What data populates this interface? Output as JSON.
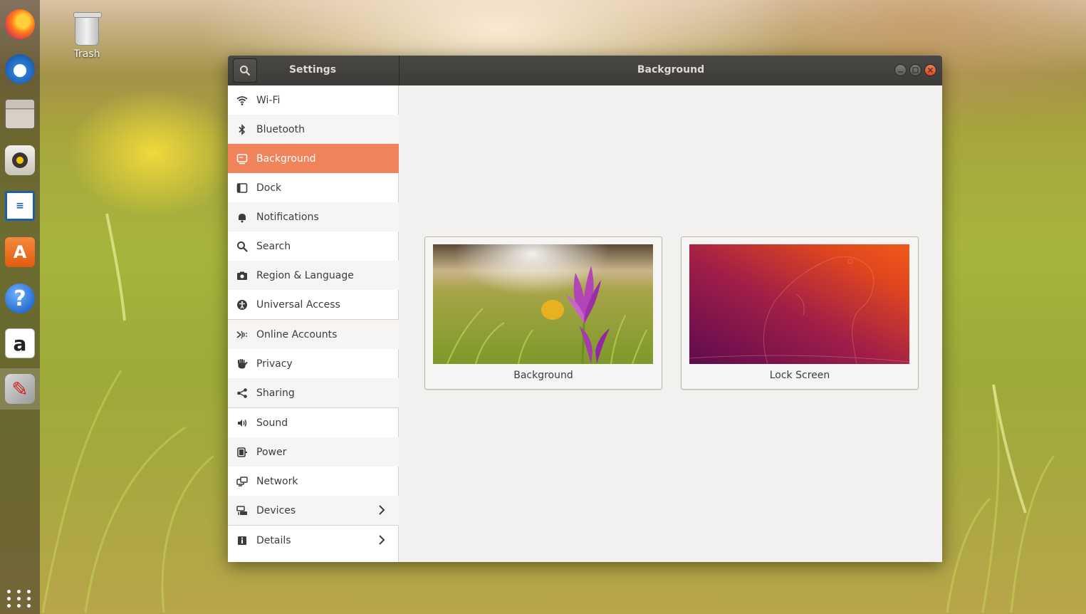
{
  "desktop": {
    "trash_label": "Trash",
    "dock_apps": [
      "firefox-icon",
      "thunderbird-icon",
      "files-icon",
      "rhythmbox-icon",
      "writer-icon",
      "software-icon",
      "help-icon",
      "amazon-icon",
      "settings-icon",
      "show-apps-icon"
    ]
  },
  "window": {
    "settings_title": "Settings",
    "page_title": "Background",
    "accent_color": "#f0835a"
  },
  "sidebar": {
    "items": [
      {
        "label": "Wi-Fi",
        "icon": "wifi-icon"
      },
      {
        "label": "Bluetooth",
        "icon": "bluetooth-icon"
      },
      {
        "label": "Background",
        "icon": "background-icon",
        "selected": true
      },
      {
        "label": "Dock",
        "icon": "dock-icon"
      },
      {
        "label": "Notifications",
        "icon": "bell-icon"
      },
      {
        "label": "Search",
        "icon": "search-icon"
      },
      {
        "label": "Region & Language",
        "icon": "camera-icon"
      },
      {
        "label": "Universal Access",
        "icon": "accessibility-icon"
      },
      {
        "label": "Online Accounts",
        "icon": "online-accounts-icon"
      },
      {
        "label": "Privacy",
        "icon": "hand-icon"
      },
      {
        "label": "Sharing",
        "icon": "share-icon"
      },
      {
        "label": "Sound",
        "icon": "speaker-icon"
      },
      {
        "label": "Power",
        "icon": "power-icon"
      },
      {
        "label": "Network",
        "icon": "network-icon"
      },
      {
        "label": "Devices",
        "icon": "devices-icon",
        "has_submenu": true
      },
      {
        "label": "Details",
        "icon": "info-icon",
        "has_submenu": true
      }
    ]
  },
  "main": {
    "cards": [
      {
        "label": "Background",
        "thumb": "crocus-flower-wallpaper"
      },
      {
        "label": "Lock Screen",
        "thumb": "ubuntu-purple-orange-wallpaper"
      }
    ]
  }
}
